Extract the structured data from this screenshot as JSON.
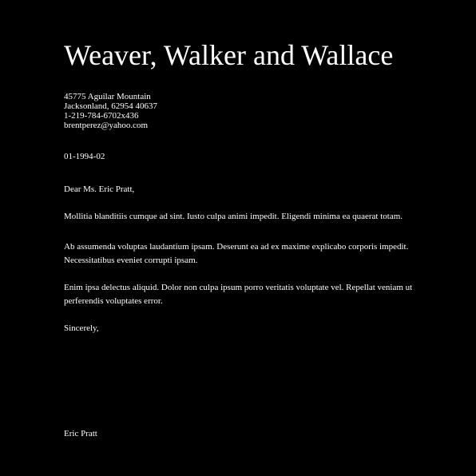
{
  "letter": {
    "company_name": "Weaver, Walker and Wallace",
    "address_lines": [
      "45775 Aguilar Mountain",
      "Jacksonland, 62954 40637",
      "1-219-784-6702x436",
      "brentperez@yahoo.com"
    ],
    "date": "01-1994-02",
    "salutation": "Dear Ms. Eric Pratt,",
    "paragraphs": [
      "Mollitia blanditiis cumque ad sint. Iusto culpa animi impedit. Eligendi minima ea quaerat totam.",
      "Ab assumenda voluptas laudantium ipsam. Deserunt ea ad ex maxime explicabo corporis impedit. Necessitatibus eveniet corrupti ipsam.",
      "Enim ipsa delectus aliquid. Dolor non culpa ipsum porro veritatis voluptate vel. Repellat veniam ut perferendis voluptates error."
    ],
    "closing": "Sincerely,",
    "signature": "Eric Pratt"
  },
  "colors": {
    "background": "#000000",
    "text": "#ffffff"
  }
}
